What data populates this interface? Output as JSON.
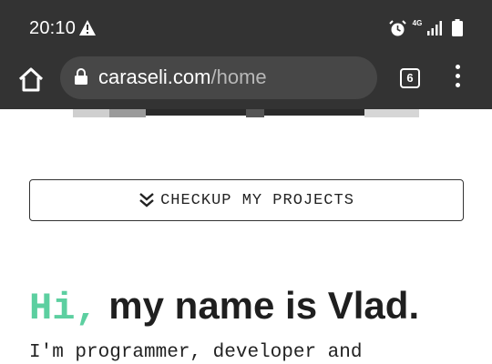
{
  "status_bar": {
    "time": "20:10",
    "network": "4G",
    "warning_icon": "warning-icon",
    "alarm_icon": "alarm-icon",
    "signal_icon": "signal-icon",
    "battery_icon": "battery-icon"
  },
  "browser": {
    "url_domain": "caraseli.com",
    "url_path": "/home",
    "tab_count": "6",
    "colors": {
      "bar": "#333333",
      "url_field": "#474747"
    }
  },
  "page": {
    "projects_button_label": "CHECKUP MY PROJECTS",
    "greeting_hi": "Hi,",
    "greeting_name": "my name is Vlad.",
    "intro_text": "I'm programmer, developer and",
    "colors": {
      "accent": "#5ccfa0",
      "text": "#1f1f1f"
    }
  }
}
